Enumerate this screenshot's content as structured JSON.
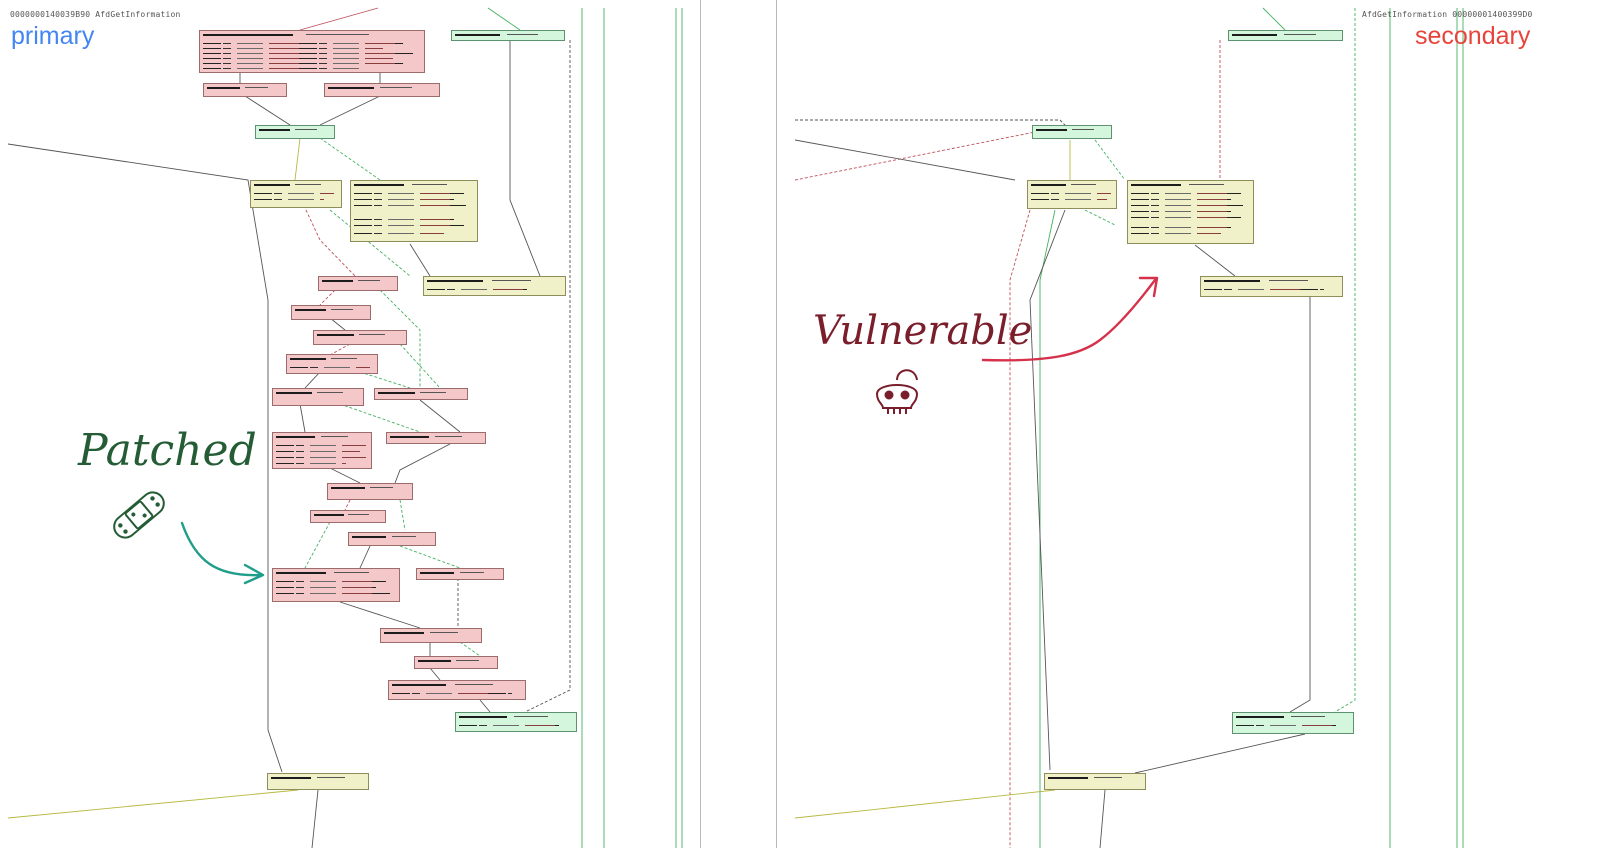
{
  "primary": {
    "address": "0000000140039B90 AfdGetInformation",
    "label": "primary",
    "label_color": "#4285f4",
    "annotation": "Patched",
    "annotation_color": "#245c35",
    "arrow_color": "#1f9e8a",
    "icon": "bandage-icon"
  },
  "secondary": {
    "address": "AfdGetInformation 00000001400399D0",
    "label": "secondary",
    "label_color": "#e8433a",
    "annotation": "Vulnerable",
    "annotation_color": "#7a1e2c",
    "arrow_color": "#d6314b",
    "icon": "skull-lock-icon"
  },
  "node_colors": {
    "changed": "#f4c8c8",
    "partial": "#f1f1c9",
    "identical": "#d3f6dd"
  }
}
